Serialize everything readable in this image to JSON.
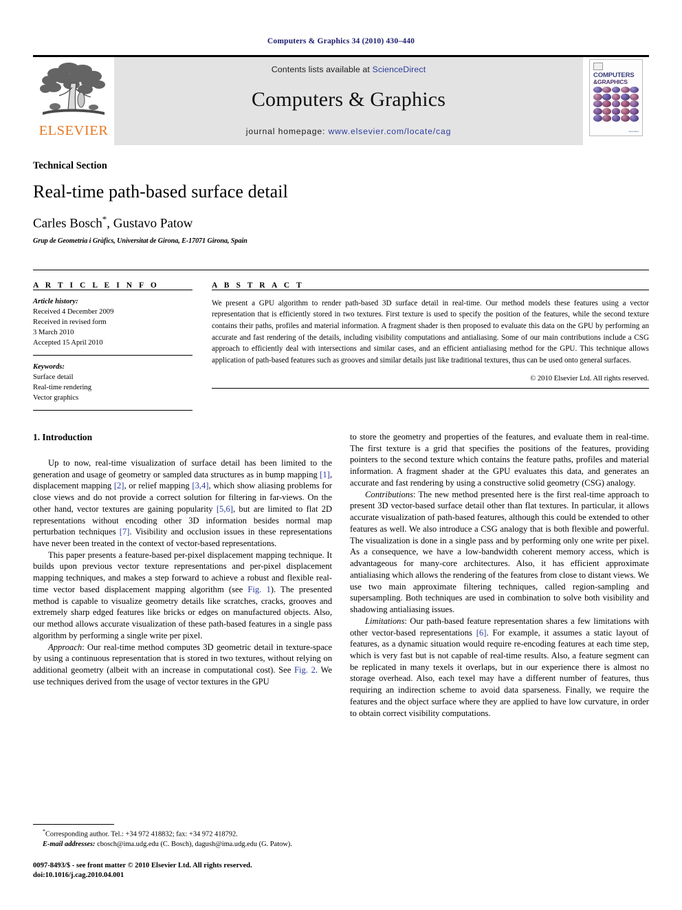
{
  "running_head": "Computers & Graphics 34 (2010) 430–440",
  "masthead": {
    "elsevier_wordmark": "ELSEVIER",
    "contents_prefix": "Contents lists available at ",
    "contents_link": "ScienceDirect",
    "journal_title": "Computers & Graphics",
    "homepage_prefix": "journal homepage: ",
    "homepage_link": "www.elsevier.com/locate/cag",
    "cover": {
      "line1": "COMPUTERS",
      "line2": "&GRAPHICS",
      "sciencedirect_label": "ScienceDirect",
      "accent_color": "#3a3f7a",
      "accent_color_2": "#4a2f6a"
    },
    "banner_color": "#e3e3e3",
    "link_color": "#2a3a9e",
    "elsevier_orange": "#E87722"
  },
  "article": {
    "section_label": "Technical Section",
    "title": "Real-time path-based surface detail",
    "authors": "Carles Bosch, Gustavo Patow",
    "author_star": "*",
    "affiliation": "Grup de Geometria i Gràfics, Universitat de Girona, E-17071 Girona, Spain"
  },
  "article_info": {
    "heading": "A R T I C L E  I N F O",
    "history_label": "Article history:",
    "history_lines": [
      "Received 4 December 2009",
      "Received in revised form",
      "3 March 2010",
      "Accepted 15 April 2010"
    ],
    "keywords_label": "Keywords:",
    "keywords": [
      "Surface detail",
      "Real-time rendering",
      "Vector graphics"
    ]
  },
  "abstract": {
    "heading": "A B S T R A C T",
    "text": "We present a GPU algorithm to render path-based 3D surface detail in real-time. Our method models these features using a vector representation that is efficiently stored in two textures. First texture is used to specify the position of the features, while the second texture contains their paths, profiles and material information. A fragment shader is then proposed to evaluate this data on the GPU by performing an accurate and fast rendering of the details, including visibility computations and antialiasing. Some of our main contributions include a CSG approach to efficiently deal with intersections and similar cases, and an efficient antialiasing method for the GPU. This technique allows application of path-based features such as grooves and similar details just like traditional textures, thus can be used onto general surfaces.",
    "copyright": "© 2010 Elsevier Ltd. All rights reserved."
  },
  "body": {
    "section_number_title": "1.  Introduction",
    "left_paragraphs": [
      {
        "parts": [
          {
            "t": "Up to now, real-time visualization of surface detail has been limited to the generation and usage of geometry or sampled data structures as in bump mapping "
          },
          {
            "t": "[1]",
            "cite": true
          },
          {
            "t": ", displacement mapping "
          },
          {
            "t": "[2]",
            "cite": true
          },
          {
            "t": ", or relief mapping "
          },
          {
            "t": "[3,4]",
            "cite": true
          },
          {
            "t": ", which show aliasing problems for close views and do not provide a correct solution for filtering in far-views. On the other hand, vector textures are gaining popularity "
          },
          {
            "t": "[5,6]",
            "cite": true
          },
          {
            "t": ", but are limited to flat 2D representations without encoding other 3D information besides normal map perturbation techniques "
          },
          {
            "t": "[7]",
            "cite": true
          },
          {
            "t": ". Visibility and occlusion issues in these representations have never been treated in the context of vector-based representations."
          }
        ]
      },
      {
        "parts": [
          {
            "t": "This paper presents a feature-based per-pixel displacement mapping technique. It builds upon previous vector texture representations and per-pixel displacement mapping techniques, and makes a step forward to achieve a robust and flexible real-time vector based displacement mapping algorithm (see "
          },
          {
            "t": "Fig. 1",
            "cite": true
          },
          {
            "t": "). The presented method is capable to visualize geometry details like scratches, cracks, grooves and extremely sharp edged features like bricks or edges on manufactured objects. Also, our method allows accurate visualization of these path-based features in a single pass algorithm by performing a single write per pixel."
          }
        ]
      },
      {
        "parts": [
          {
            "t": "Approach",
            "italic": true
          },
          {
            "t": ": Our real-time method computes 3D geometric detail in texture-space by using a continuous representation that is stored in two textures, without relying on additional geometry (albeit with an increase in computational cost). See "
          },
          {
            "t": "Fig. 2",
            "cite": true
          },
          {
            "t": ". We use techniques derived from the usage of vector textures in the GPU"
          }
        ]
      }
    ],
    "right_paragraphs": [
      {
        "first": true,
        "parts": [
          {
            "t": "to store the geometry and properties of the features, and evaluate them in real-time. The first texture is a grid that specifies the positions of the features, providing pointers to the second texture which contains the feature paths, profiles and material information. A fragment shader at the GPU evaluates this data, and generates an accurate and fast rendering by using a constructive solid geometry (CSG) analogy."
          }
        ]
      },
      {
        "parts": [
          {
            "t": "Contributions",
            "italic": true
          },
          {
            "t": ": The new method presented here is the first real-time approach to present 3D vector-based surface detail other than flat textures. In particular, it allows accurate visualization of path-based features, although this could be extended to other features as well. We also introduce a CSG analogy that is both flexible and powerful. The visualization is done in a single pass and by performing only one write per pixel. As a consequence, we have a low-bandwidth coherent memory access, which is advantageous for many-core architectures. Also, it has efficient approximate antialiasing which allows the rendering of the features from close to distant views. We use two main approximate filtering techniques, called region-sampling and supersampling. Both techniques are used in combination to solve both visibility and shadowing antialiasing issues."
          }
        ]
      },
      {
        "parts": [
          {
            "t": "Limitations",
            "italic": true
          },
          {
            "t": ": Our path-based feature representation shares a few limitations with other vector-based representations "
          },
          {
            "t": "[6]",
            "cite": true
          },
          {
            "t": ". For example, it assumes a static layout of features, as a dynamic situation would require re-encoding features at each time step, which is very fast but is not capable of real-time results. Also, a feature segment can be replicated in many texels it overlaps, but in our experience there is almost no storage overhead. Also, each texel may have a different number of features, thus requiring an indirection scheme to avoid data sparseness. Finally, we require the features and the object surface where they are applied to have low curvature, in order to obtain correct visibility computations."
          }
        ]
      }
    ]
  },
  "footnotes": {
    "corresponding": "Corresponding author. Tel.: +34 972 418832; fax: +34 972 418792.",
    "email_label": "E-mail addresses:",
    "email_text": " cbosch@ima.udg.edu (C. Bosch), dagush@ima.udg.edu (G. Patow).",
    "front_matter_line1": "0097-8493/$ - see front matter © 2010 Elsevier Ltd. All rights reserved.",
    "front_matter_line2": "doi:10.1016/j.cag.2010.04.001"
  }
}
